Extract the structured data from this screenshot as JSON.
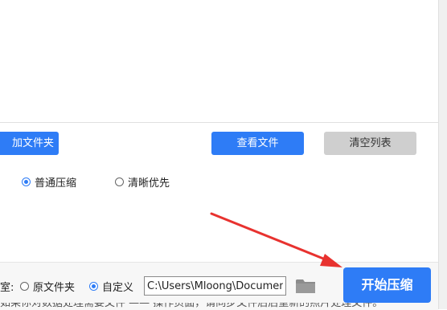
{
  "toolbar": {
    "add_folder_label": "加文件夹",
    "view_files_label": "查看文件",
    "clear_list_label": "清空列表"
  },
  "compression_mode": {
    "options": [
      {
        "label": "普通压缩",
        "checked": true
      },
      {
        "label": "清晰优先",
        "checked": false
      }
    ]
  },
  "output": {
    "label_fragment": "室:",
    "options": [
      {
        "label": "原文件夹",
        "checked": false
      },
      {
        "label": "自定义",
        "checked": true
      }
    ],
    "path_value": "C:\\Users\\Mloong\\Documents",
    "folder_icon": "folder-icon",
    "start_label": "开始压缩"
  },
  "colors": {
    "primary": "#2e7cf6",
    "disabled": "#cfcfcf",
    "annotation_arrow": "#e8322f"
  },
  "bottom_text_fragment": "如果你对数据处理需要文件 —— 操作页面，请同步文件后后重新的照片处理文件。"
}
